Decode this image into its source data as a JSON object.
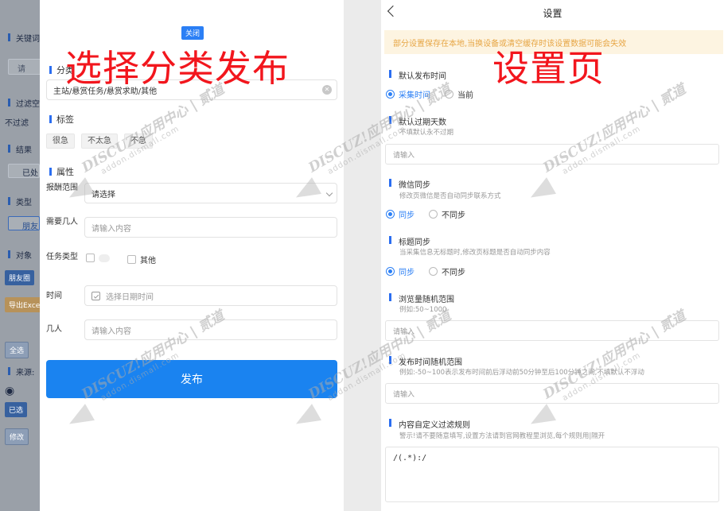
{
  "backdrop": {
    "keyword": "关键词",
    "search_hint": "请",
    "filter": "过滤空",
    "no_filter": "不过滤",
    "result": "结果",
    "already": "已处",
    "type": "类型",
    "friend": "朋友",
    "target": "对象",
    "friends_circle": "朋友圈",
    "export": "导出Excel",
    "select_all": "全选",
    "source": "来源:",
    "selected": "已选",
    "modify": "修改"
  },
  "left": {
    "close_label": "关闭",
    "overlay_caption": "选择分类发布",
    "category": {
      "title": "分类",
      "value": "主站/悬赏任务/悬赏求助/其他"
    },
    "tags": {
      "title": "标签",
      "items": [
        "很急",
        "不太急",
        "不急"
      ]
    },
    "attributes": {
      "title": "属性",
      "reward_range_label": "报酬范围",
      "reward_range_value": "请选择",
      "people_needed_label": "需要几人",
      "people_needed_placeholder": "请输入内容",
      "task_type_label": "任务类型",
      "task_type_options": [
        "其他"
      ],
      "time_label": "时间",
      "time_placeholder": "选择日期时间",
      "count_label": "几人",
      "count_placeholder": "请输入内容"
    },
    "publish_label": "发布"
  },
  "right": {
    "nav_title": "设置",
    "overlay_caption": "设置页",
    "notice": "部分设置保存在本地,当换设备或清空缓存时该设置数据可能会失效",
    "default_publish_time": {
      "title": "默认发布时间",
      "options": [
        "采集时间",
        "当前"
      ],
      "selected": 0
    },
    "default_expire_days": {
      "title": "默认过期天数",
      "hint": "不填默认永不过期",
      "placeholder": "请输入"
    },
    "wechat_sync": {
      "title": "微信同步",
      "hint": "修改页微信是否自动同步联系方式",
      "options": [
        "同步",
        "不同步"
      ],
      "selected": 0
    },
    "title_sync": {
      "title": "标题同步",
      "hint": "当采集信息无标题时,修改页标题是否自动同步内容",
      "options": [
        "同步",
        "不同步"
      ],
      "selected": 0
    },
    "view_range": {
      "title": "浏览量随机范围",
      "hint": "例如:50~1000",
      "placeholder": "请输入"
    },
    "publish_time_range": {
      "title": "发布时间随机范围",
      "hint": "例如:-50~100表示发布时间前后浮动前50分钟至后100分钟之间,不填默认不浮动",
      "placeholder": "请输入"
    },
    "content_filter": {
      "title": "内容自定义过滤规则",
      "hint": "警示!请不要随意填写,设置方法请到官网教程里浏览,每个规则用|隔开",
      "value": "/(.*):/"
    }
  },
  "watermark": {
    "main": "DISCUZ!应用中心 | 贰道",
    "sub": "addon.dismall.com"
  },
  "colors": {
    "accent": "#2b7ff5",
    "caption_red": "#f2161d",
    "notice_bg": "#fdf4e1",
    "notice_text": "#e7a645"
  }
}
